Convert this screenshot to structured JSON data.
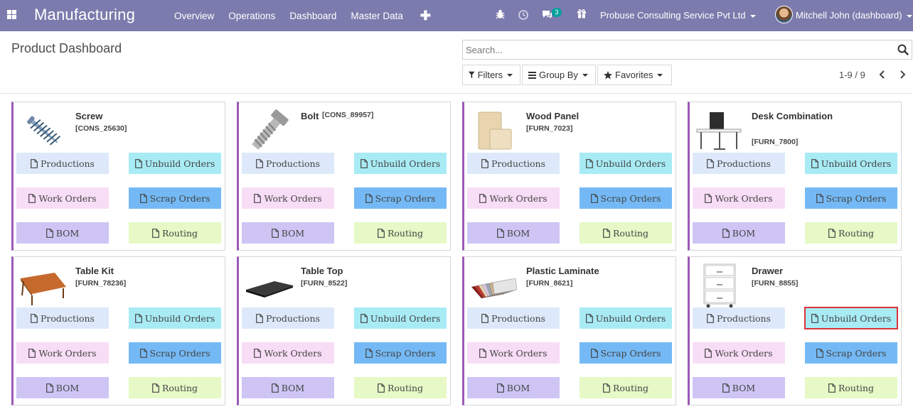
{
  "navbar": {
    "brand": "Manufacturing",
    "menu": [
      "Overview",
      "Operations",
      "Dashboard",
      "Master Data"
    ],
    "add_symbol": "✚",
    "messages_count": "3",
    "company": "Probuse Consulting Service Pvt Ltd",
    "user": "Mitchell John (dashboard)",
    "icons": [
      "apps-icon",
      "bug-icon",
      "clock-icon",
      "chat-icon",
      "gift-icon"
    ],
    "color": "#7c7bad"
  },
  "control_panel": {
    "title": "Product Dashboard",
    "search_placeholder": "Search...",
    "filters_label": "Filters",
    "group_by_label": "Group By",
    "favorites_label": "Favorites",
    "pager": "1-9 / 9"
  },
  "button_labels": {
    "productions": "Productions",
    "unbuild": "Unbuild Orders",
    "work": "Work Orders",
    "scrap": "Scrap Orders",
    "bom": "BOM",
    "routing": "Routing"
  },
  "colors": {
    "card_border_accent": "#9b59b6",
    "productions": "#dde9fa",
    "unbuild": "#a8ebf5",
    "work": "#f8ddf6",
    "scrap": "#74b9f5",
    "bom": "#cec5f5",
    "routing": "#e6f9c6",
    "selected_outline": "#d9343a"
  },
  "products": [
    {
      "name": "Screw",
      "code": "[CONS_25630]",
      "image": "screw"
    },
    {
      "name": "Bolt",
      "code": "[CONS_89957]",
      "image": "bolt"
    },
    {
      "name": "Wood Panel",
      "code": "[FURN_7023]",
      "image": "wood-panel"
    },
    {
      "name": "Desk Combination",
      "code": "[FURN_7800]",
      "image": "desk"
    },
    {
      "name": "Table Kit",
      "code": "[FURN_78236]",
      "image": "table-kit"
    },
    {
      "name": "Table Top",
      "code": "[FURN_8522]",
      "image": "table-top"
    },
    {
      "name": "Plastic Laminate",
      "code": "[FURN_8621]",
      "image": "laminate"
    },
    {
      "name": "Drawer",
      "code": "[FURN_8855]",
      "image": "drawer",
      "highlighted_button": "unbuild"
    }
  ]
}
